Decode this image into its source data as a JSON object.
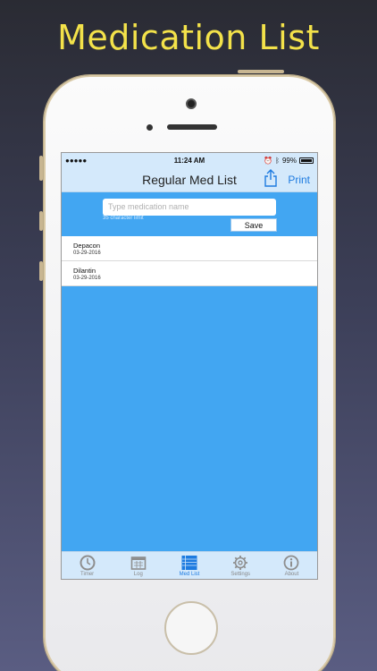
{
  "headline": "Medication List",
  "status_bar": {
    "signal": "●●●●●",
    "time": "11:24 AM",
    "battery": "99%"
  },
  "nav": {
    "title": "Regular Med List",
    "print_label": "Print"
  },
  "entry": {
    "placeholder": "Type medication name",
    "limit_hint": "35 character limit",
    "save_label": "Save"
  },
  "medications": [
    {
      "name": "Depacon",
      "date": "03-29-2016"
    },
    {
      "name": "Dilantin",
      "date": "03-29-2016"
    }
  ],
  "tabs": [
    {
      "label": "Timer",
      "icon": "clock-icon",
      "active": false
    },
    {
      "label": "Log",
      "icon": "calendar-icon",
      "active": false
    },
    {
      "label": "Med List",
      "icon": "list-icon",
      "active": true
    },
    {
      "label": "Settings",
      "icon": "gear-icon",
      "active": false
    },
    {
      "label": "About",
      "icon": "info-icon",
      "active": false
    }
  ],
  "colors": {
    "headline": "#f3e24a",
    "screen_bg": "#42a6f2",
    "bar_bg": "#d4e9fb",
    "accent": "#1e7be0"
  }
}
